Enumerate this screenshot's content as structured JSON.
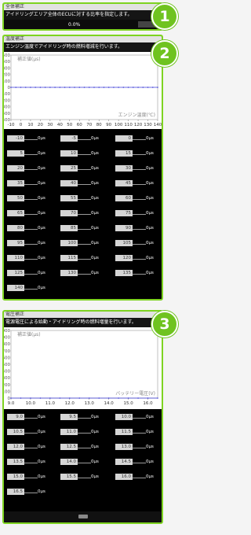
{
  "badges": [
    "1",
    "2",
    "3"
  ],
  "panel1": {
    "title": "全体補正",
    "desc": "アイドリングエリア全体のECUに対する比率を指定します。",
    "progress": "0.0%"
  },
  "panel2": {
    "title": "温度補正",
    "desc": "エンジン温度でアイドリング時の燃料増減を行います。",
    "cells": [
      {
        "x": "-10",
        "v": "0μs"
      },
      {
        "x": "-5",
        "v": "0μs"
      },
      {
        "x": "0",
        "v": "0μs"
      },
      {
        "x": "5",
        "v": "0μs"
      },
      {
        "x": "10",
        "v": "0μs"
      },
      {
        "x": "15",
        "v": "0μs"
      },
      {
        "x": "20",
        "v": "0μs"
      },
      {
        "x": "25",
        "v": "0μs"
      },
      {
        "x": "30",
        "v": "0μs"
      },
      {
        "x": "35",
        "v": "0μs"
      },
      {
        "x": "40",
        "v": "0μs"
      },
      {
        "x": "45",
        "v": "0μs"
      },
      {
        "x": "50",
        "v": "0μs"
      },
      {
        "x": "55",
        "v": "0μs"
      },
      {
        "x": "60",
        "v": "0μs"
      },
      {
        "x": "65",
        "v": "0μs"
      },
      {
        "x": "70",
        "v": "0μs"
      },
      {
        "x": "75",
        "v": "0μs"
      },
      {
        "x": "80",
        "v": "0μs"
      },
      {
        "x": "85",
        "v": "0μs"
      },
      {
        "x": "90",
        "v": "0μs"
      },
      {
        "x": "95",
        "v": "0μs"
      },
      {
        "x": "100",
        "v": "0μs"
      },
      {
        "x": "105",
        "v": "0μs"
      },
      {
        "x": "110",
        "v": "0μs"
      },
      {
        "x": "115",
        "v": "0μs"
      },
      {
        "x": "120",
        "v": "0μs"
      },
      {
        "x": "125",
        "v": "0μs"
      },
      {
        "x": "130",
        "v": "0μs"
      },
      {
        "x": "135",
        "v": "0μs"
      },
      {
        "x": "140",
        "v": "0μs"
      }
    ]
  },
  "panel3": {
    "title": "電圧補正",
    "desc": "電源電圧による始動・アイドリング時の燃料増量を行います。",
    "cells": [
      {
        "x": "9.0",
        "v": "0μs"
      },
      {
        "x": "9.5",
        "v": "0μs"
      },
      {
        "x": "10.0",
        "v": "0μs"
      },
      {
        "x": "10.5",
        "v": "0μs"
      },
      {
        "x": "11.0",
        "v": "0μs"
      },
      {
        "x": "11.5",
        "v": "0μs"
      },
      {
        "x": "12.0",
        "v": "0μs"
      },
      {
        "x": "12.5",
        "v": "0μs"
      },
      {
        "x": "13.0",
        "v": "0μs"
      },
      {
        "x": "13.5",
        "v": "0μs"
      },
      {
        "x": "14.0",
        "v": "0μs"
      },
      {
        "x": "14.5",
        "v": "0μs"
      },
      {
        "x": "15.0",
        "v": "0μs"
      },
      {
        "x": "15.5",
        "v": "0μs"
      },
      {
        "x": "16.0",
        "v": "0μs"
      },
      {
        "x": "16.5",
        "v": "0μs"
      }
    ]
  },
  "chart_data": [
    {
      "type": "line",
      "ylabel": "補正値(μs)",
      "xlabel": "エンジン温度(℃)",
      "x": [
        "-10",
        "-5",
        "0",
        "5",
        "10",
        "15",
        "20",
        "25",
        "30",
        "35",
        "40",
        "45",
        "50",
        "55",
        "60",
        "65",
        "70",
        "75",
        "80",
        "85",
        "90",
        "95",
        "100",
        "105",
        "110",
        "115",
        "120",
        "125",
        "130",
        "135",
        "140"
      ],
      "y_ticks": [
        "500",
        "400",
        "300",
        "200",
        "100",
        "0",
        "-100",
        "-200",
        "-300",
        "-400",
        "-500"
      ],
      "x_ticks": [
        "-10",
        "0",
        "10",
        "20",
        "30",
        "40",
        "50",
        "60",
        "70",
        "80",
        "90",
        "100",
        "110",
        "120",
        "130",
        "140"
      ],
      "ylim": [
        -500,
        500
      ],
      "series": [
        {
          "values": [
            0,
            0,
            0,
            0,
            0,
            0,
            0,
            0,
            0,
            0,
            0,
            0,
            0,
            0,
            0,
            0,
            0,
            0,
            0,
            0,
            0,
            0,
            0,
            0,
            0,
            0,
            0,
            0,
            0,
            0,
            0
          ]
        }
      ],
      "line_color": "#3b3bd6"
    },
    {
      "type": "line",
      "ylabel": "補正値(μs)",
      "xlabel": "バッテリー電圧(V)",
      "x": [
        "9.0",
        "9.5",
        "10.0",
        "10.5",
        "11.0",
        "11.5",
        "12.0",
        "12.5",
        "13.0",
        "13.5",
        "14.0",
        "14.5",
        "15.0",
        "15.5",
        "16.0",
        "16.5"
      ],
      "y_ticks": [
        "1000",
        "900",
        "800",
        "700",
        "600",
        "500",
        "400",
        "300",
        "200",
        "100",
        "0"
      ],
      "x_ticks": [
        "9.0",
        "10.0",
        "11.0",
        "12.0",
        "13.0",
        "14.0",
        "15.0",
        "16.0"
      ],
      "ylim": [
        0,
        1000
      ],
      "series": [
        {
          "values": [
            0,
            0,
            0,
            0,
            0,
            0,
            0,
            0,
            0,
            0,
            0,
            0,
            0,
            0,
            0,
            0
          ]
        }
      ],
      "line_color": "#3b3bd6"
    }
  ]
}
